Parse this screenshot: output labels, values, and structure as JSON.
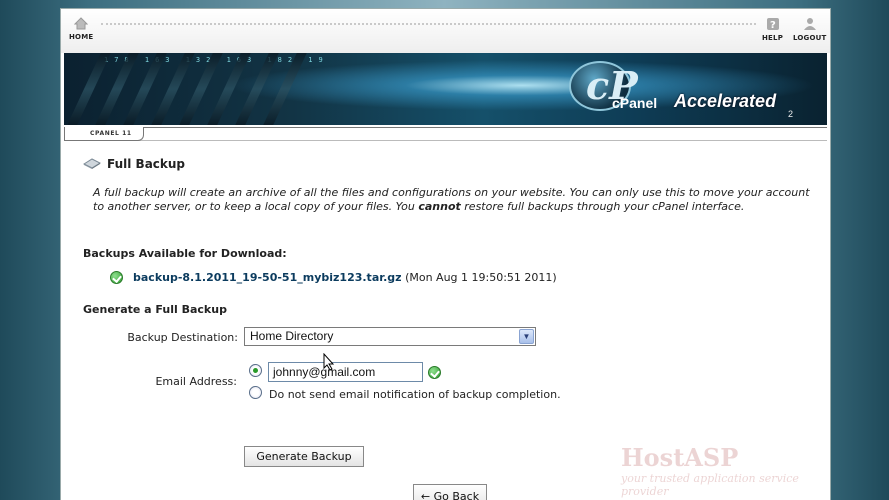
{
  "nav": {
    "home_label": "HOME",
    "help_label": "HELP",
    "logout_label": "LOGOUT"
  },
  "banner": {
    "logo_letters": "cP",
    "brand": "cPanel",
    "product": "Accelerated",
    "product_version": "2",
    "numbers": "178 163 132 163 182 19"
  },
  "version_label": "CPANEL 11",
  "page": {
    "title": "Full Backup",
    "description_part1": "A full backup will create an archive of all the files and configurations on your website. You can only use this to move your account to another server, or to keep a local copy of your files. You ",
    "description_bold": "cannot",
    "description_part2": " restore full backups through your cPanel interface."
  },
  "backups": {
    "section_title": "Backups Available for Download:",
    "items": [
      {
        "filename": "backup-8.1.2011_19-50-51_mybiz123.tar.gz",
        "date": "(Mon Aug 1 19:50:51 2011)"
      }
    ]
  },
  "generate": {
    "section_title": "Generate a Full Backup",
    "destination_label": "Backup Destination:",
    "destination_value": "Home Directory",
    "email_label": "Email Address:",
    "email_value": "johnny@gmail.com",
    "no_email_label": "Do not send email notification of backup completion.",
    "generate_button": "Generate Backup"
  },
  "go_back_label": "← Go Back",
  "watermark": {
    "title": "HostASP",
    "subtitle": "your trusted application service provider"
  }
}
